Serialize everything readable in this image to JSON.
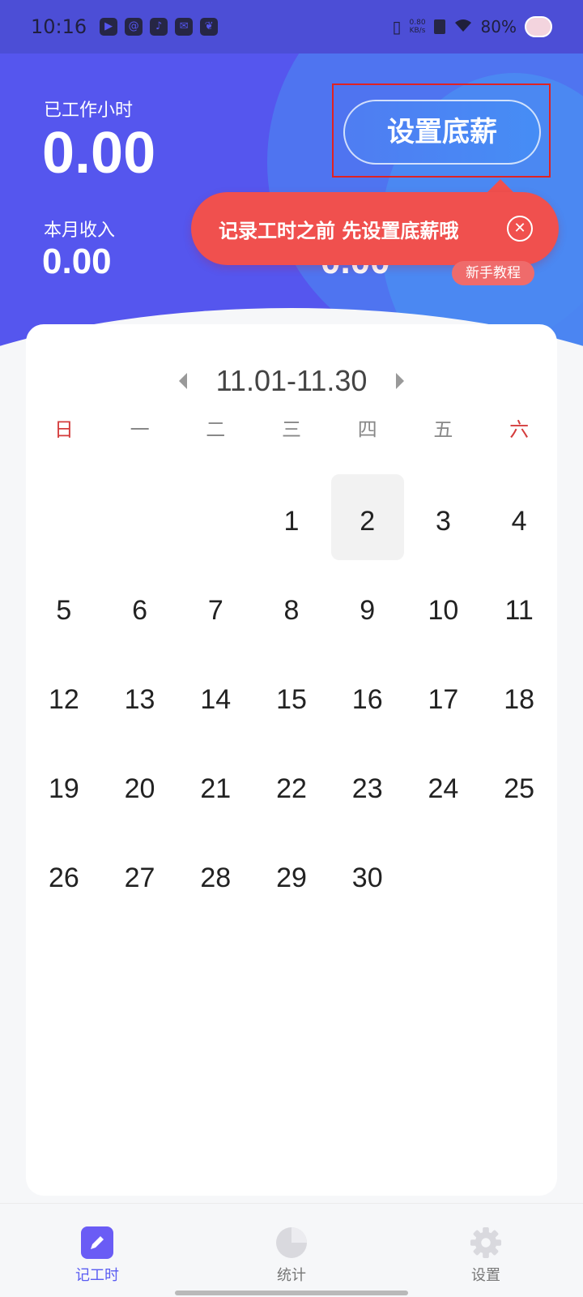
{
  "status_bar": {
    "time": "10:16",
    "speed": "0.80\nKB/s",
    "battery": "80%",
    "app_icons": [
      "play-app-icon",
      "chat-app-icon",
      "tiktok-icon",
      "mail-app-icon",
      "leaf-app-icon"
    ]
  },
  "summary": {
    "hours_label": "已工作小时",
    "hours_value": "0.00",
    "income_label": "本月收入",
    "income_value": "0.00",
    "other_value": "0.00"
  },
  "set_salary_button": "设置底薪",
  "tooltip": {
    "text": "记录工时之前 先设置底薪哦",
    "close": "✕"
  },
  "tutorial_badge": "新手教程",
  "calendar": {
    "range": "11.01-11.30",
    "weekdays": [
      "日",
      "一",
      "二",
      "三",
      "四",
      "五",
      "六"
    ],
    "days": [
      "",
      "",
      "",
      "1",
      "2",
      "3",
      "4",
      "5",
      "6",
      "7",
      "8",
      "9",
      "10",
      "11",
      "12",
      "13",
      "14",
      "15",
      "16",
      "17",
      "18",
      "19",
      "20",
      "21",
      "22",
      "23",
      "24",
      "25",
      "26",
      "27",
      "28",
      "29",
      "30",
      "",
      ""
    ],
    "selected_day": "2"
  },
  "bottom_nav": [
    {
      "label": "记工时",
      "icon": "pencil-icon",
      "active": true
    },
    {
      "label": "统计",
      "icon": "pie-chart-icon",
      "active": false
    },
    {
      "label": "设置",
      "icon": "gear-icon",
      "active": false
    }
  ],
  "colors": {
    "header": "#5556ee",
    "accent": "#5a5cf2",
    "tooltip": "#f0504e",
    "weekend": "#d43c3c"
  }
}
